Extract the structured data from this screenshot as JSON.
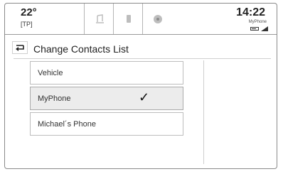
{
  "status_bar": {
    "temperature": "22°",
    "temperature_sub": "[TP]",
    "clock": "14:22",
    "device_name": "MyPhone",
    "tabs": [
      {
        "icon": "audio-icon"
      },
      {
        "icon": "phone-icon"
      },
      {
        "icon": "settings-icon"
      }
    ]
  },
  "page": {
    "title": "Change Contacts List"
  },
  "contacts_list": {
    "items": [
      {
        "label": "Vehicle",
        "selected": false
      },
      {
        "label": "MyPhone",
        "selected": true
      },
      {
        "label": "Michael´s Phone",
        "selected": false
      }
    ]
  }
}
